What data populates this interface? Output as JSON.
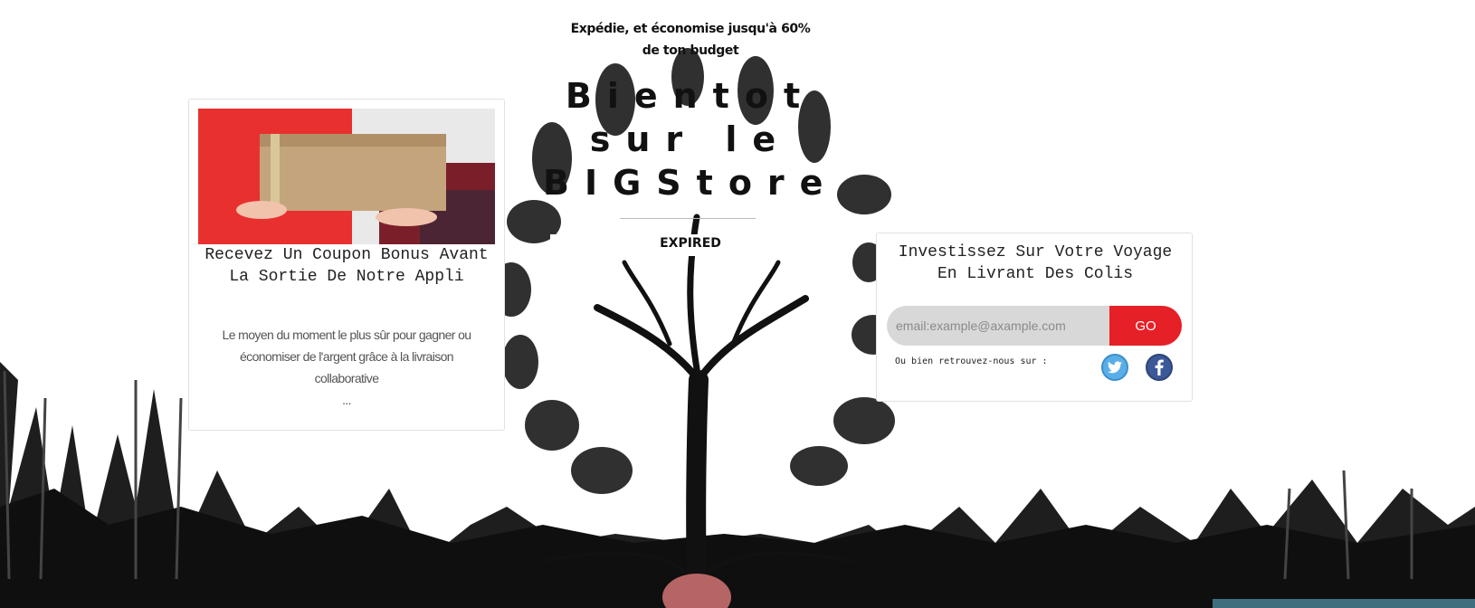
{
  "header": {
    "tagline": "Expédie, et économise jusqu'à 60% de ton budget",
    "title_lines": [
      "Bientot",
      "sur le",
      "BIGStore"
    ],
    "status": "EXPIRED"
  },
  "left_card": {
    "title": "Recevez Un Coupon Bonus Avant La Sortie De Notre Appli",
    "description": "Le moyen du moment le plus sûr pour gagner ou économiser de l'argent grâce à la livraison collaborative",
    "ellipsis": "..."
  },
  "right_card": {
    "title": "Investissez Sur Votre Voyage En Livrant Des Colis",
    "email_placeholder": "email:example@axample.com",
    "go_label": "GO",
    "social_label": "Ou bien retrouvez-nous sur :"
  },
  "icons": {
    "twitter": "twitter-icon",
    "facebook": "facebook-icon"
  },
  "colors": {
    "accent": "#e62027",
    "twitter": "#5aaee8",
    "facebook": "#3b5998",
    "corner_bar": "#3f6f7e"
  }
}
